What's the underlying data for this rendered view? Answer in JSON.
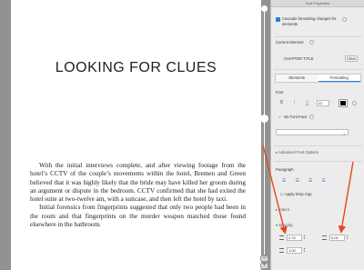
{
  "document": {
    "chapter_title": "LOOKING FOR CLUES",
    "paragraphs": [
      "With the initial interviews complete, and after viewing footage from the hotel’s CCTV of the couple’s movements within the hotel, Bremen and Green believed that it was highly likely that the bride may have killed her groom during an argument or dispute in the bedroom. CCTV confirmed that she had exited the hotel suite at two-twelve am, with a suitcase, and then left the hotel by taxi.",
      "Initial forensics from fingerprints suggested that only two people had been in the room and that fingerprints on the murder weapon matched those found elsewhere in the bathroom."
    ]
  },
  "slider": {
    "minus_label": "−",
    "plus_label": "+"
  },
  "panel": {
    "title": "Text Properties",
    "cascade_label": "Cascade formatting changes for elements",
    "current_element_heading": "Current Element",
    "current_element_value": "CHAPTER TITLE",
    "clear_label": "Clear",
    "tabs": [
      {
        "label": "Elements"
      },
      {
        "label": "Formatting"
      }
    ],
    "active_tab": "Formatting",
    "font_heading": "Font",
    "bold_label": "B",
    "italic_label": "I",
    "underline_label": "U",
    "font_size": "22",
    "text_color": "#000000",
    "no_font_face_label": "No Font Face",
    "advanced_font_options_label": "Advanced Font Options",
    "paragraph_heading": "Paragraph",
    "drop_cap_label": "Apply Drop Cap",
    "indent_label": "Indent",
    "spacing_label": "Spacing",
    "spacing_before": "2.75",
    "spacing_after": "0.00",
    "line_spacing": "1.00"
  },
  "colors": {
    "accent": "#2d7be0",
    "arrow": "#e8451e"
  }
}
